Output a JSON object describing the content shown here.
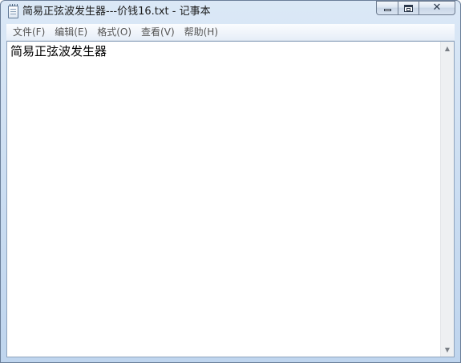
{
  "window": {
    "title": "简易正弦波发生器---价钱16.txt - 记事本",
    "app_icon": "notepad-icon",
    "caption": {
      "minimize_icon": "minimize-icon",
      "maximize_icon": "restore-icon",
      "close_icon": "close-icon",
      "close_glyph": "✕"
    }
  },
  "menu": {
    "items": [
      {
        "label": "文件(F)"
      },
      {
        "label": "编辑(E)"
      },
      {
        "label": "格式(O)"
      },
      {
        "label": "查看(V)"
      },
      {
        "label": "帮助(H)"
      }
    ]
  },
  "editor": {
    "content": "简易正弦波发生器"
  },
  "scrollbar": {
    "up_glyph": "▲",
    "down_glyph": "▼"
  }
}
